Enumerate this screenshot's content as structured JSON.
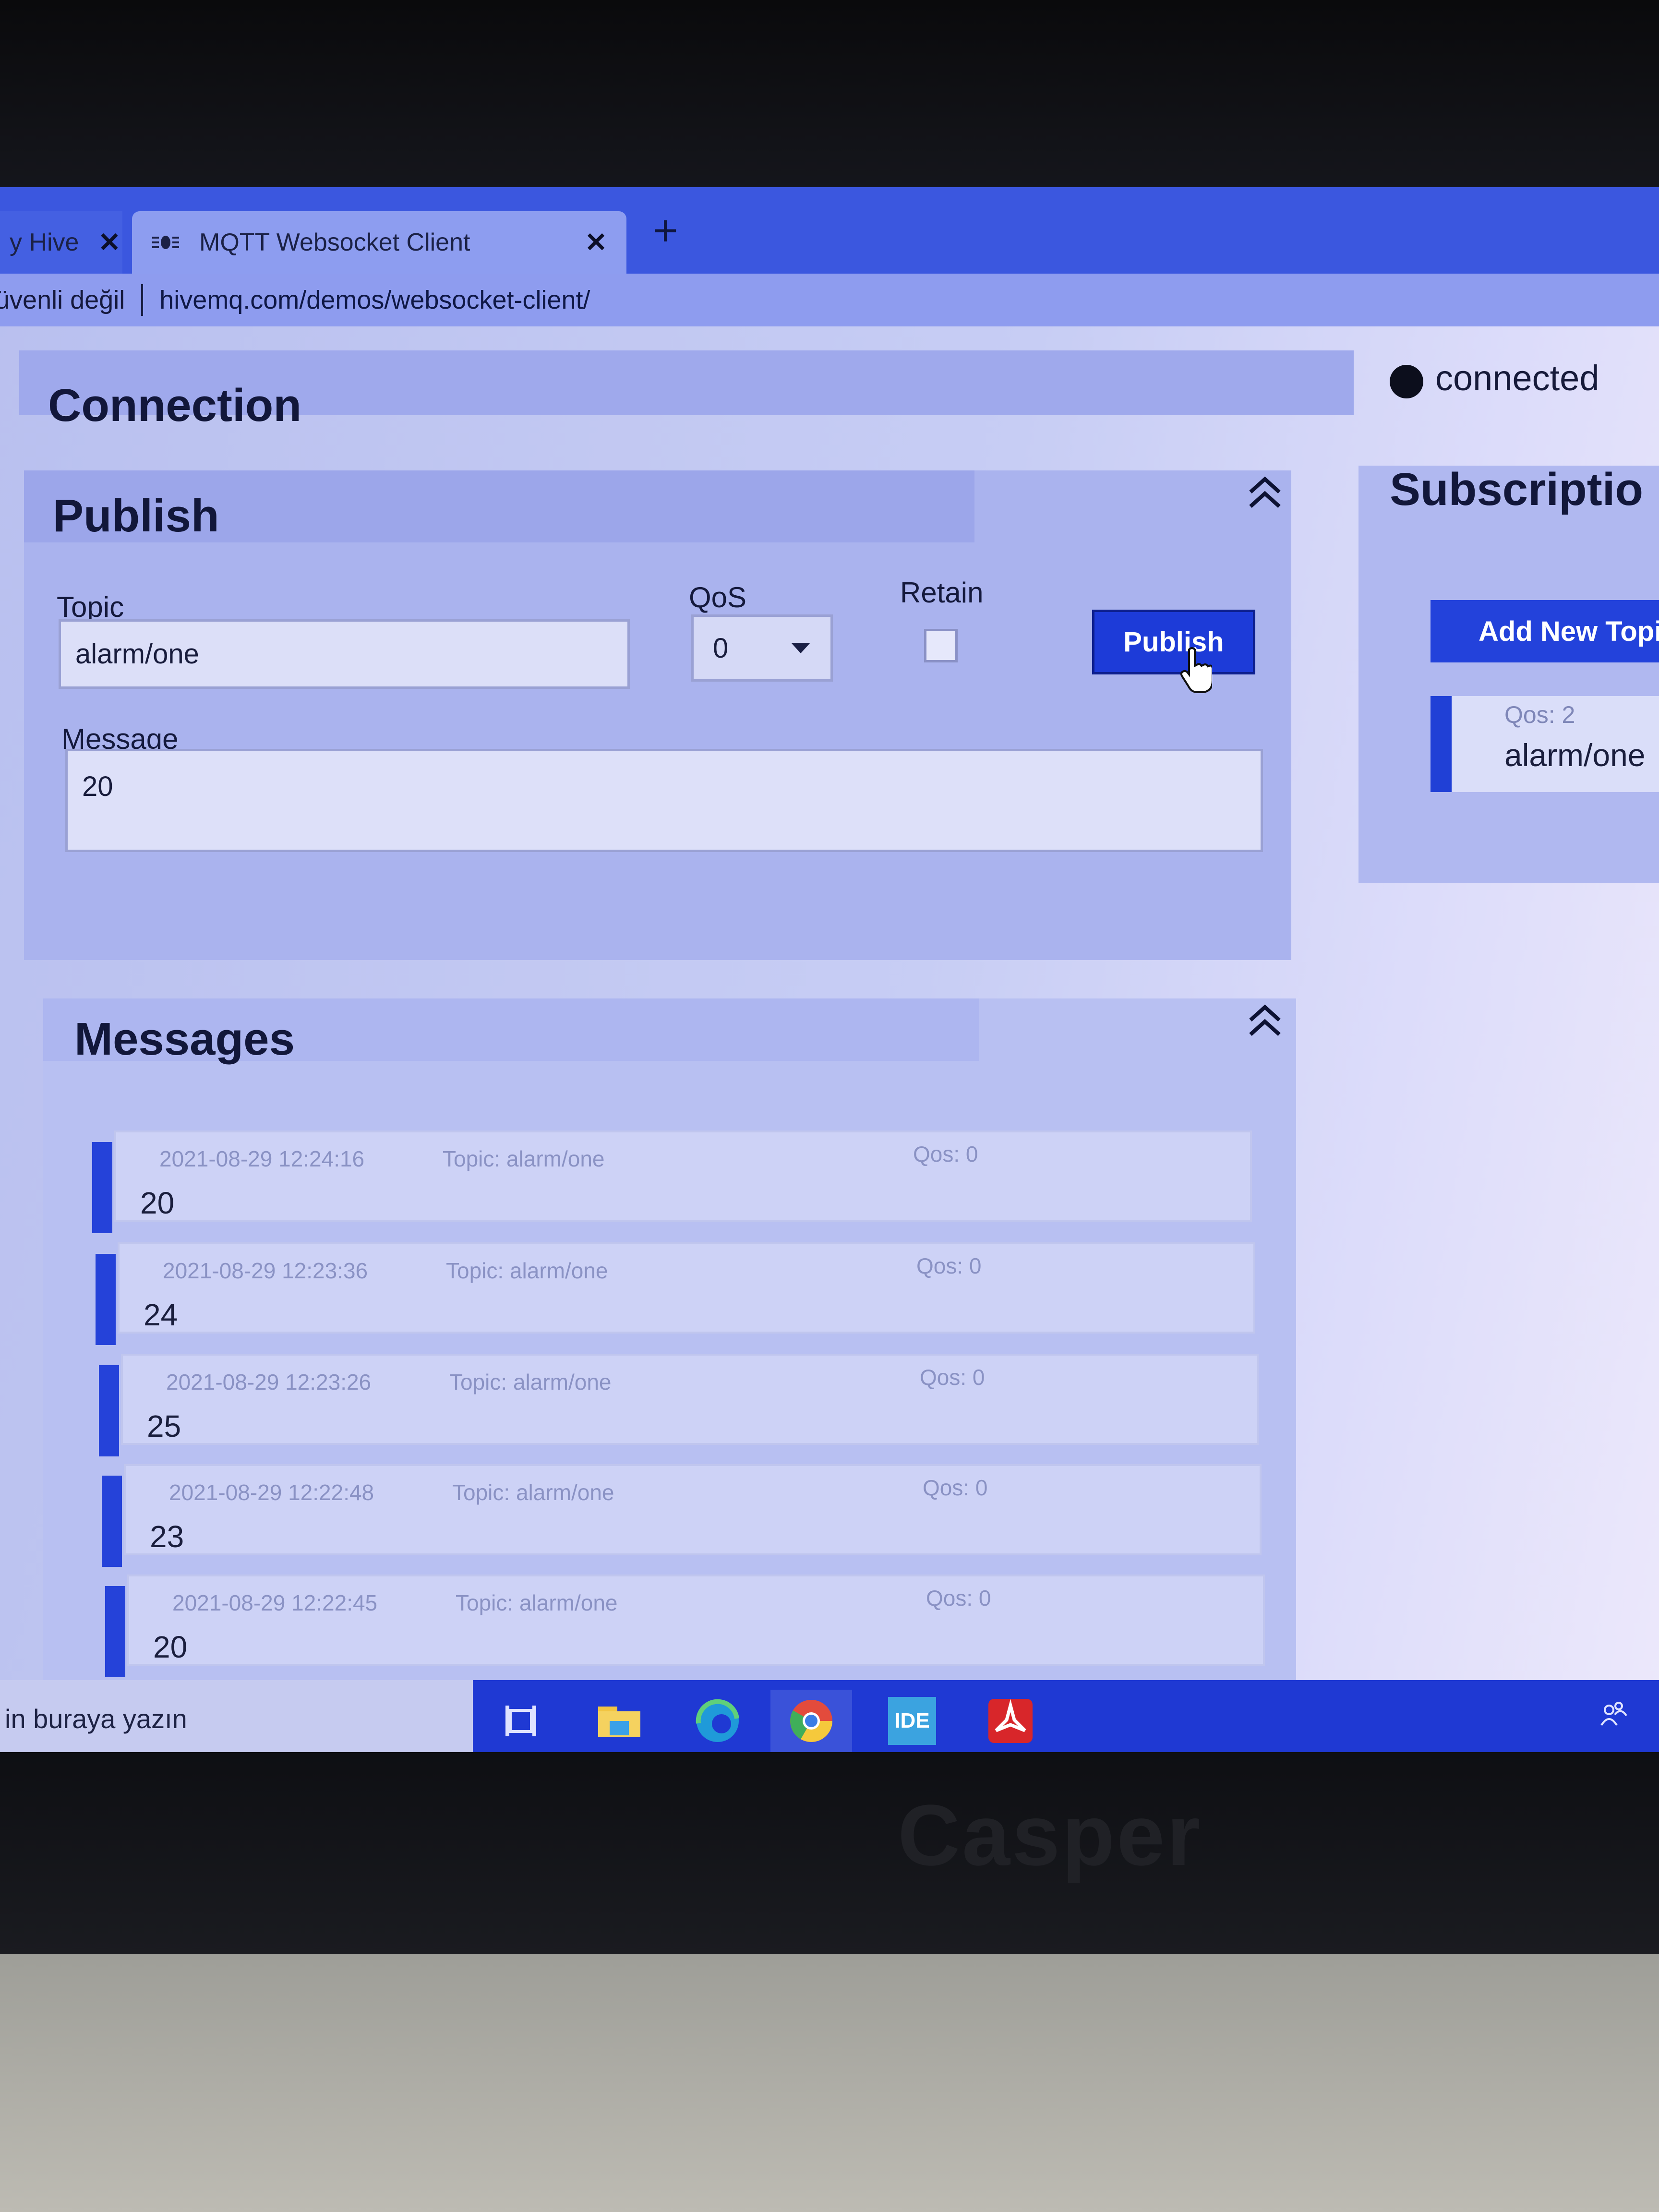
{
  "browser": {
    "prev_tab_label": "y Hive",
    "active_tab_label": "MQTT Websocket Client",
    "close_glyph": "✕",
    "new_tab_glyph": "+",
    "security_label": "üvenli değil",
    "url": "hivemq.com/demos/websocket-client/"
  },
  "status": {
    "text": "connected"
  },
  "connection": {
    "title": "Connection"
  },
  "publish": {
    "title": "Publish",
    "topic_label": "Topic",
    "topic_value": "alarm/one",
    "qos_label": "QoS",
    "qos_value": "0",
    "retain_label": "Retain",
    "retain_checked": false,
    "button_label": "Publish",
    "message_label": "Message",
    "message_value": "20"
  },
  "subscriptions": {
    "title": "Subscriptio",
    "add_button": "Add New Topi",
    "items": [
      {
        "qos": "Qos: 2",
        "topic": "alarm/one",
        "color": "#2040d6"
      }
    ]
  },
  "messages": {
    "title": "Messages",
    "items": [
      {
        "time": "2021-08-29 12:24:16",
        "topic": "Topic: alarm/one",
        "qos": "Qos: 0",
        "value": "20"
      },
      {
        "time": "2021-08-29 12:23:36",
        "topic": "Topic: alarm/one",
        "qos": "Qos: 0",
        "value": "24"
      },
      {
        "time": "2021-08-29 12:23:26",
        "topic": "Topic: alarm/one",
        "qos": "Qos: 0",
        "value": "25"
      },
      {
        "time": "2021-08-29 12:22:48",
        "topic": "Topic: alarm/one",
        "qos": "Qos: 0",
        "value": "23"
      },
      {
        "time": "2021-08-29 12:22:45",
        "topic": "Topic: alarm/one",
        "qos": "Qos: 0",
        "value": "20"
      }
    ]
  },
  "taskbar": {
    "search_placeholder": "in buraya yazın",
    "icons": [
      "task-view-icon",
      "file-explorer-icon",
      "edge-icon",
      "chrome-icon",
      "ide-icon",
      "acrobat-icon"
    ],
    "ide_label": "IDE"
  },
  "device": {
    "brand": "Casper"
  },
  "colors": {
    "accent": "#1d3bd8",
    "tab_strip": "#3b57df"
  }
}
